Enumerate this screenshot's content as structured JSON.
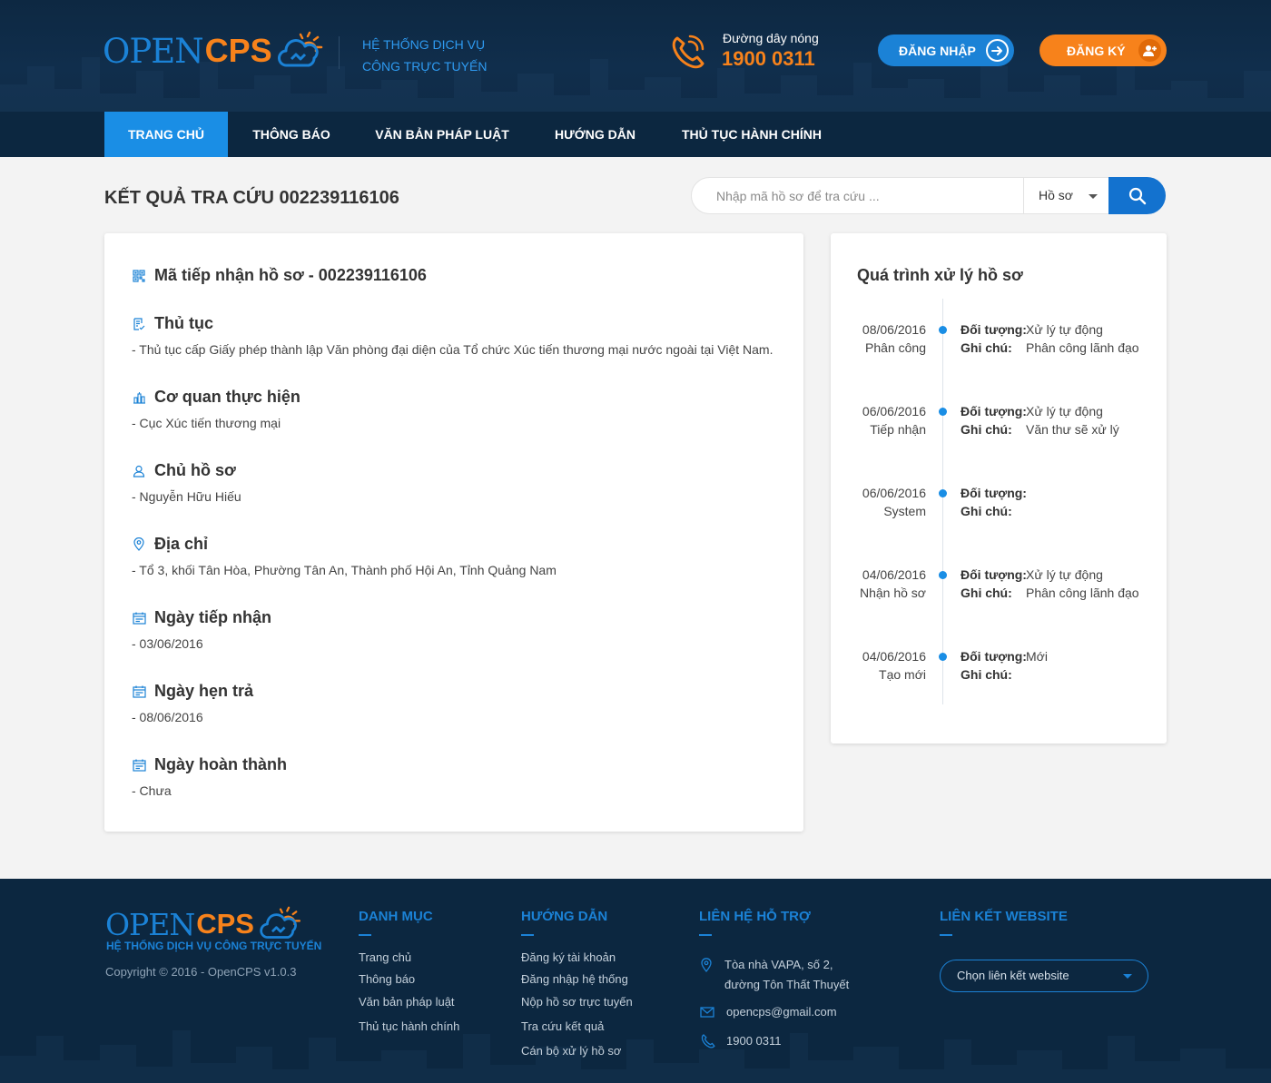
{
  "header": {
    "logo_open": "OPEN",
    "logo_cps": "CPS",
    "subtitle_line1": "HỆ THỐNG DỊCH VỤ",
    "subtitle_line2": "CÔNG TRỰC TUYẾN",
    "hotline_label": "Đường dây nóng",
    "hotline_number": "1900 0311",
    "login_label": "ĐĂNG NHẬP",
    "register_label": "ĐĂNG KÝ"
  },
  "nav": {
    "items": [
      {
        "label": "TRANG CHỦ",
        "active": true
      },
      {
        "label": "THÔNG BÁO",
        "active": false
      },
      {
        "label": "VĂN BẢN PHÁP LUẬT",
        "active": false
      },
      {
        "label": "HƯỚNG DẪN",
        "active": false
      },
      {
        "label": "THỦ TỤC HÀNH CHÍNH",
        "active": false
      }
    ]
  },
  "main": {
    "title": "KẾT QUẢ TRA CỨU 002239116106",
    "search": {
      "placeholder": "Nhập mã hồ sơ để tra cứu ...",
      "select_value": "Hồ sơ"
    }
  },
  "detail": {
    "sections": [
      {
        "icon": "qrcode-icon",
        "heading": "Mã tiếp nhận hồ sơ - 002239116106",
        "value": ""
      },
      {
        "icon": "document-check-icon",
        "heading": "Thủ tục",
        "value": "- Thủ tục cấp Giấy phép thành lập Văn phòng đại diện của Tổ chức Xúc tiến thương mại nước ngoài tại Việt Nam."
      },
      {
        "icon": "building-icon",
        "heading": "Cơ quan thực hiện",
        "value": "- Cục Xúc tiến thương mại"
      },
      {
        "icon": "user-icon",
        "heading": "Chủ hồ sơ",
        "value": "- Nguyễn Hữu Hiếu"
      },
      {
        "icon": "location-pin-icon",
        "heading": "Địa chỉ",
        "value": "- Tổ 3, khối Tân Hòa, Phường Tân An, Thành phố Hội An, Tỉnh Quảng Nam"
      },
      {
        "icon": "calendar-icon",
        "heading": "Ngày tiếp nhận",
        "value": "- 03/06/2016"
      },
      {
        "icon": "calendar-icon",
        "heading": "Ngày hẹn trả",
        "value": "- 08/06/2016"
      },
      {
        "icon": "calendar-icon",
        "heading": "Ngày hoàn thành",
        "value": "- Chưa"
      }
    ]
  },
  "process": {
    "title": "Quá trình xử lý hồ sơ",
    "label_object": "Đối tượng:",
    "label_note": "Ghi chú:",
    "entries": [
      {
        "date": "08/06/2016",
        "step": "Phân công",
        "object": "Xử lý tự động",
        "note": "Phân công lãnh đạo"
      },
      {
        "date": "06/06/2016",
        "step": "Tiếp nhận",
        "object": "Xử lý tự động",
        "note": "Văn thư sẽ xử lý"
      },
      {
        "date": "06/06/2016",
        "step": "System",
        "object": "",
        "note": ""
      },
      {
        "date": "04/06/2016",
        "step": "Nhận hồ sơ",
        "object": "Xử lý tự động",
        "note": "Phân công lãnh đạo"
      },
      {
        "date": "04/06/2016",
        "step": "Tạo mới",
        "object": "Mới",
        "note": ""
      }
    ]
  },
  "footer": {
    "logo_sub": "HỆ THỐNG DỊCH VỤ CÔNG TRỰC TUYẾN",
    "copyright": "Copyright © 2016 - OpenCPS v1.0.3",
    "col_category": {
      "title": "DANH MỤC",
      "links": [
        "Trang chủ",
        "Thông báo",
        "Văn bản pháp luật",
        "Thủ tục hành chính"
      ]
    },
    "col_guide": {
      "title": "HƯỚNG DẪN",
      "links": [
        "Đăng ký tài khoản",
        "Đăng nhập hệ thống",
        "Nộp hồ sơ trực tuyến",
        "Tra cứu kết quả",
        "Cán bộ xử lý hồ sơ"
      ]
    },
    "col_contact": {
      "title": "LIÊN HỆ HỖ TRỢ",
      "address_line1": "Tòa nhà VAPA, số 2,",
      "address_line2": "đường Tôn Thất Thuyết",
      "email": "opencps@gmail.com",
      "phone": "1900 0311"
    },
    "col_links": {
      "title": "LIÊN KẾT WEBSITE",
      "select_value": "Chọn liên kết website"
    }
  },
  "colors": {
    "primary_blue": "#1b82d6",
    "accent_orange": "#f7821b",
    "header_bg": "#0c2740",
    "nav_active": "#1a8ee5"
  }
}
